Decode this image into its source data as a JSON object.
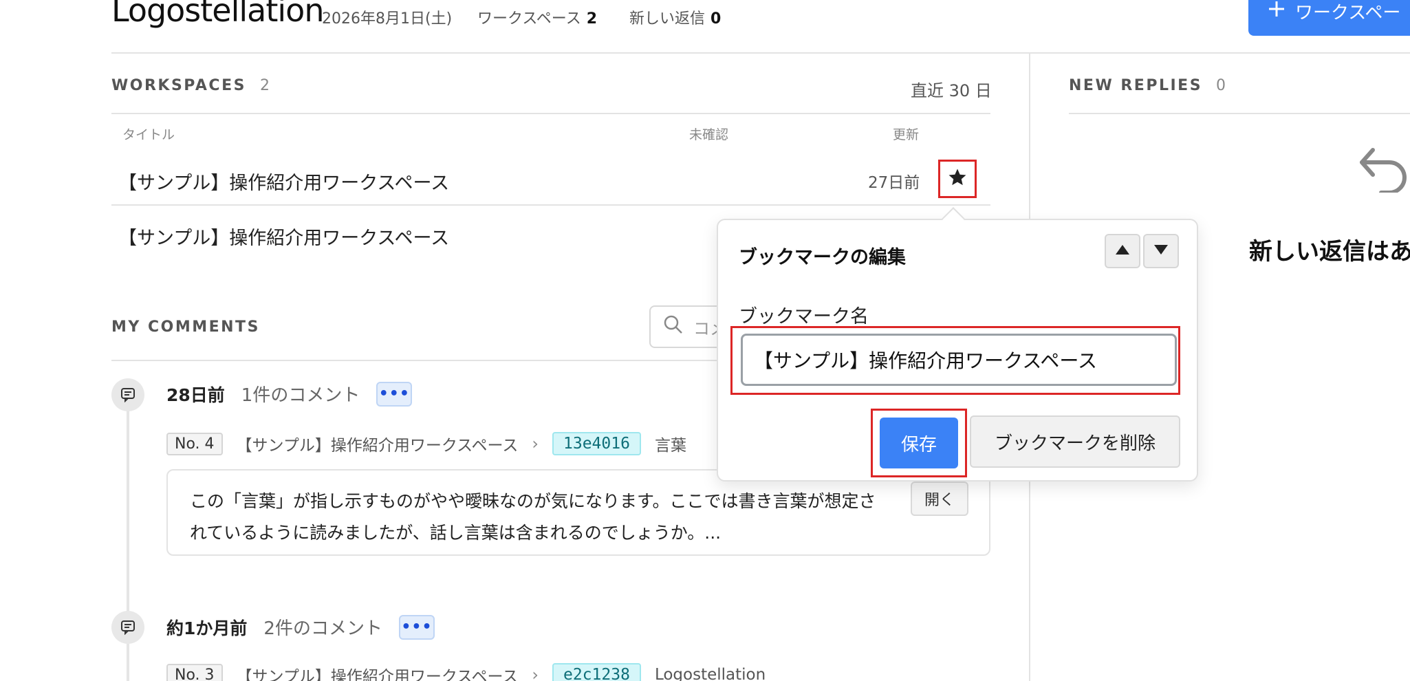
{
  "header": {
    "app_title": "Logostellation",
    "date": "2026年8月1日(土)",
    "workspaces_label": "ワークスペース",
    "workspaces_count": "2",
    "new_replies_label": "新しい返信",
    "new_replies_count": "0",
    "new_workspace_button": "ワークスペー",
    "plus_icon": "plus-icon"
  },
  "workspaces": {
    "title": "WORKSPACES",
    "count": "2",
    "range": "直近 30 日",
    "columns": {
      "title": "タイトル",
      "unconfirmed": "未確認",
      "updated": "更新"
    },
    "rows": [
      {
        "title": "【サンプル】操作紹介用ワークスペース",
        "updated": "27日前",
        "icon": "star-icon"
      },
      {
        "title": "【サンプル】操作紹介用ワークスペース"
      }
    ]
  },
  "comments": {
    "title": "MY COMMENTS",
    "search_placeholder": "コメ",
    "search_icon": "search-icon",
    "items": [
      {
        "when": "28日前",
        "count": "1件のコメント",
        "more": "•••",
        "no": "No. 4",
        "workspace": "【サンプル】操作紹介用ワークスペース",
        "hash": "13e4016",
        "term": "言葉",
        "text": "この「言葉」が指し示すものがやや曖昧なのが気になります。ここでは書き言葉が想定されているように読みましたが、話し言葉は含まれるのでしょうか。...",
        "open": "開く"
      },
      {
        "when": "約1か月前",
        "count": "2件のコメント",
        "more": "•••",
        "no": "No. 3",
        "workspace": "【サンプル】操作紹介用ワークスペース",
        "hash": "e2c1238",
        "term": "Logostellation"
      }
    ]
  },
  "replies": {
    "title": "NEW REPLIES",
    "count": "0",
    "empty_message": "新しい返信はあ",
    "icon": "undo-icon"
  },
  "popover": {
    "title": "ブックマークの編集",
    "name_label": "ブックマーク名",
    "name_value": "【サンプル】操作紹介用ワークスペース",
    "save": "保存",
    "delete": "ブックマークを削除"
  },
  "colors": {
    "accent": "#3b82f6",
    "highlight": "#dc2626",
    "hash_bg": "#d5f6f9"
  }
}
